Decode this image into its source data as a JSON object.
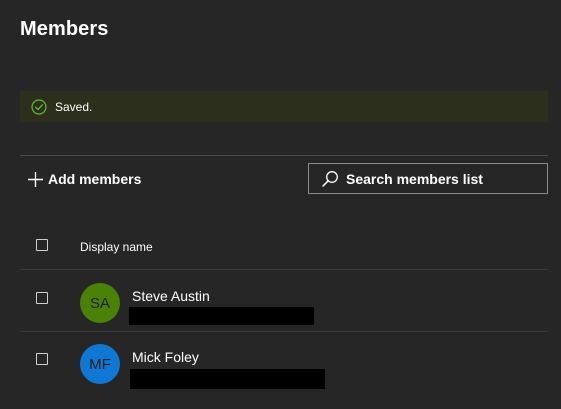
{
  "page": {
    "title": "Members"
  },
  "banner": {
    "text": "Saved.",
    "icon": "check-circle-icon",
    "background": "#2c2f1c",
    "icon_color": "#5fba3a"
  },
  "toolbar": {
    "add_label": "Add members",
    "add_icon": "plus-icon",
    "search_placeholder": "Search members list",
    "search_icon": "search-icon"
  },
  "table": {
    "header": {
      "display_name": "Display name"
    },
    "rows": [
      {
        "initials": "SA",
        "name": "Steve Austin",
        "avatar_color": "#498205",
        "detail_redacted": true
      },
      {
        "initials": "MF",
        "name": "Mick Foley",
        "avatar_color": "#0f78d4",
        "detail_redacted": true
      }
    ]
  }
}
